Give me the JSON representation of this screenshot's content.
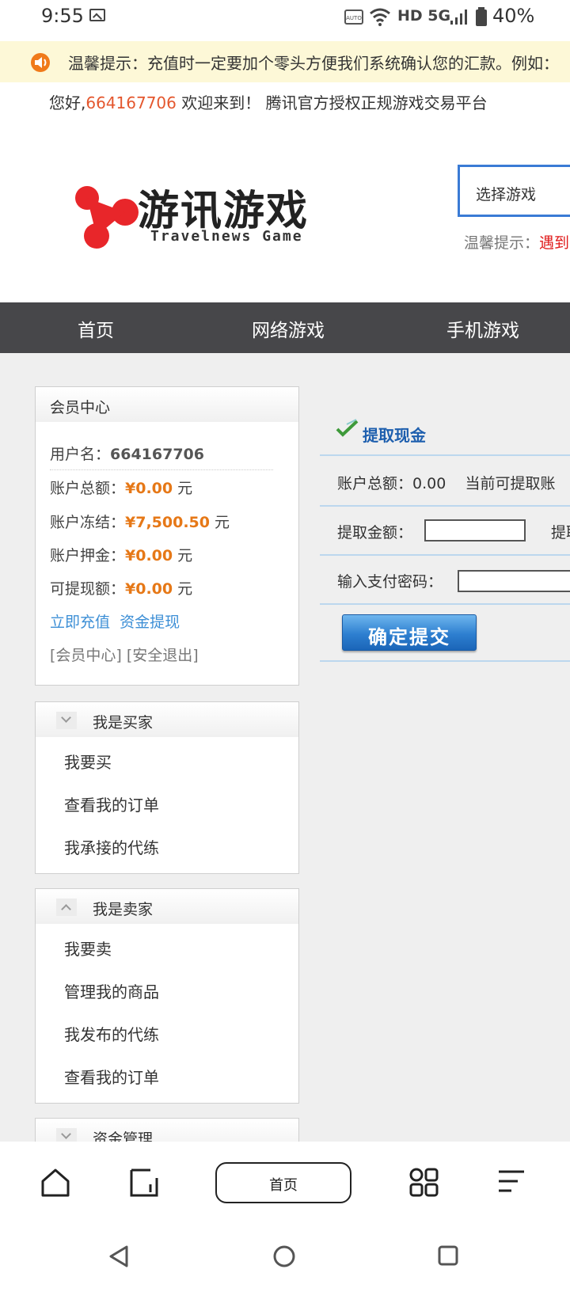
{
  "status": {
    "time": "9:55",
    "indicators": "HD 5G",
    "battery": "40%"
  },
  "notice": {
    "text": "温馨提示：充值时一定要加个零头方便我们系统确认您的汇款。例如："
  },
  "welcome": {
    "prefix": "您好,",
    "user_id": "664167706",
    "suffix": " 欢迎来到！  腾讯官方授权正规游戏交易平台"
  },
  "logo": {
    "title": "游讯游戏",
    "subtitle": "Travelnews Game"
  },
  "search": {
    "select_label": "选择游戏"
  },
  "tip": {
    "label": "温馨提示：",
    "red": "遇到"
  },
  "nav": {
    "items": [
      "首页",
      "网络游戏",
      "手机游戏"
    ]
  },
  "member": {
    "title": "会员中心",
    "username_label": "用户名：",
    "username": "664167706",
    "total_label": "账户总额：",
    "total": "¥0.00",
    "frozen_label": "账户冻结：",
    "frozen": "¥7,500.50",
    "deposit_label": "账户押金：",
    "deposit": "¥0.00",
    "withdrawable_label": "可提现额：",
    "withdrawable": "¥0.00",
    "unit": "元",
    "recharge": "立即充值",
    "withdraw": "资金提现",
    "member_center": "[会员中心]",
    "logout": "[安全退出]"
  },
  "buyer": {
    "title": "我是买家",
    "items": [
      "我要买",
      "查看我的订单",
      "我承接的代练"
    ]
  },
  "seller": {
    "title": "我是卖家",
    "items": [
      "我要卖",
      "管理我的商品",
      "我发布的代练",
      "查看我的订单"
    ]
  },
  "funds": {
    "title": "资金管理"
  },
  "withdraw_form": {
    "title": "提取现金",
    "total_label": "账户总额：",
    "total_value": "0.00",
    "available_label": "当前可提取账",
    "amount_label": "提取金额：",
    "amount_hint": "提取",
    "pay_password_label": "输入支付密码：",
    "submit": "确定提交"
  },
  "bottom": {
    "home": "首页"
  }
}
